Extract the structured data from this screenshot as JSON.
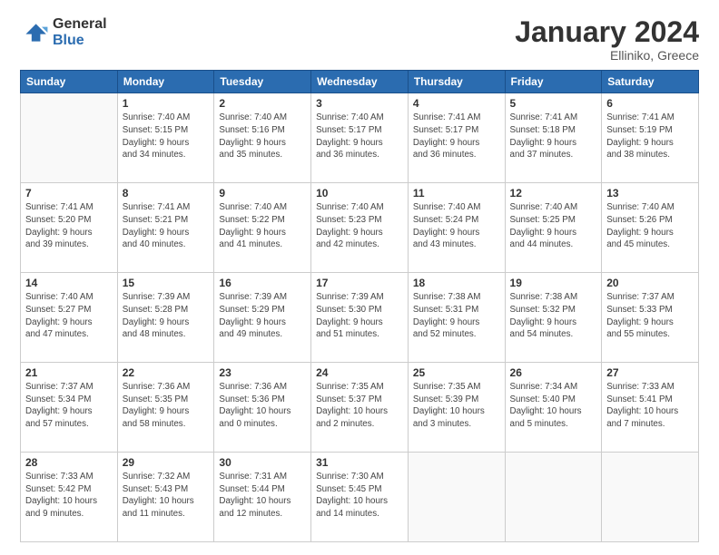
{
  "logo": {
    "general": "General",
    "blue": "Blue"
  },
  "title": "January 2024",
  "location": "Elliniko, Greece",
  "days_header": [
    "Sunday",
    "Monday",
    "Tuesday",
    "Wednesday",
    "Thursday",
    "Friday",
    "Saturday"
  ],
  "weeks": [
    [
      {
        "day": "",
        "info": ""
      },
      {
        "day": "1",
        "info": "Sunrise: 7:40 AM\nSunset: 5:15 PM\nDaylight: 9 hours\nand 34 minutes."
      },
      {
        "day": "2",
        "info": "Sunrise: 7:40 AM\nSunset: 5:16 PM\nDaylight: 9 hours\nand 35 minutes."
      },
      {
        "day": "3",
        "info": "Sunrise: 7:40 AM\nSunset: 5:17 PM\nDaylight: 9 hours\nand 36 minutes."
      },
      {
        "day": "4",
        "info": "Sunrise: 7:41 AM\nSunset: 5:17 PM\nDaylight: 9 hours\nand 36 minutes."
      },
      {
        "day": "5",
        "info": "Sunrise: 7:41 AM\nSunset: 5:18 PM\nDaylight: 9 hours\nand 37 minutes."
      },
      {
        "day": "6",
        "info": "Sunrise: 7:41 AM\nSunset: 5:19 PM\nDaylight: 9 hours\nand 38 minutes."
      }
    ],
    [
      {
        "day": "7",
        "info": "Sunrise: 7:41 AM\nSunset: 5:20 PM\nDaylight: 9 hours\nand 39 minutes."
      },
      {
        "day": "8",
        "info": "Sunrise: 7:41 AM\nSunset: 5:21 PM\nDaylight: 9 hours\nand 40 minutes."
      },
      {
        "day": "9",
        "info": "Sunrise: 7:40 AM\nSunset: 5:22 PM\nDaylight: 9 hours\nand 41 minutes."
      },
      {
        "day": "10",
        "info": "Sunrise: 7:40 AM\nSunset: 5:23 PM\nDaylight: 9 hours\nand 42 minutes."
      },
      {
        "day": "11",
        "info": "Sunrise: 7:40 AM\nSunset: 5:24 PM\nDaylight: 9 hours\nand 43 minutes."
      },
      {
        "day": "12",
        "info": "Sunrise: 7:40 AM\nSunset: 5:25 PM\nDaylight: 9 hours\nand 44 minutes."
      },
      {
        "day": "13",
        "info": "Sunrise: 7:40 AM\nSunset: 5:26 PM\nDaylight: 9 hours\nand 45 minutes."
      }
    ],
    [
      {
        "day": "14",
        "info": "Sunrise: 7:40 AM\nSunset: 5:27 PM\nDaylight: 9 hours\nand 47 minutes."
      },
      {
        "day": "15",
        "info": "Sunrise: 7:39 AM\nSunset: 5:28 PM\nDaylight: 9 hours\nand 48 minutes."
      },
      {
        "day": "16",
        "info": "Sunrise: 7:39 AM\nSunset: 5:29 PM\nDaylight: 9 hours\nand 49 minutes."
      },
      {
        "day": "17",
        "info": "Sunrise: 7:39 AM\nSunset: 5:30 PM\nDaylight: 9 hours\nand 51 minutes."
      },
      {
        "day": "18",
        "info": "Sunrise: 7:38 AM\nSunset: 5:31 PM\nDaylight: 9 hours\nand 52 minutes."
      },
      {
        "day": "19",
        "info": "Sunrise: 7:38 AM\nSunset: 5:32 PM\nDaylight: 9 hours\nand 54 minutes."
      },
      {
        "day": "20",
        "info": "Sunrise: 7:37 AM\nSunset: 5:33 PM\nDaylight: 9 hours\nand 55 minutes."
      }
    ],
    [
      {
        "day": "21",
        "info": "Sunrise: 7:37 AM\nSunset: 5:34 PM\nDaylight: 9 hours\nand 57 minutes."
      },
      {
        "day": "22",
        "info": "Sunrise: 7:36 AM\nSunset: 5:35 PM\nDaylight: 9 hours\nand 58 minutes."
      },
      {
        "day": "23",
        "info": "Sunrise: 7:36 AM\nSunset: 5:36 PM\nDaylight: 10 hours\nand 0 minutes."
      },
      {
        "day": "24",
        "info": "Sunrise: 7:35 AM\nSunset: 5:37 PM\nDaylight: 10 hours\nand 2 minutes."
      },
      {
        "day": "25",
        "info": "Sunrise: 7:35 AM\nSunset: 5:39 PM\nDaylight: 10 hours\nand 3 minutes."
      },
      {
        "day": "26",
        "info": "Sunrise: 7:34 AM\nSunset: 5:40 PM\nDaylight: 10 hours\nand 5 minutes."
      },
      {
        "day": "27",
        "info": "Sunrise: 7:33 AM\nSunset: 5:41 PM\nDaylight: 10 hours\nand 7 minutes."
      }
    ],
    [
      {
        "day": "28",
        "info": "Sunrise: 7:33 AM\nSunset: 5:42 PM\nDaylight: 10 hours\nand 9 minutes."
      },
      {
        "day": "29",
        "info": "Sunrise: 7:32 AM\nSunset: 5:43 PM\nDaylight: 10 hours\nand 11 minutes."
      },
      {
        "day": "30",
        "info": "Sunrise: 7:31 AM\nSunset: 5:44 PM\nDaylight: 10 hours\nand 12 minutes."
      },
      {
        "day": "31",
        "info": "Sunrise: 7:30 AM\nSunset: 5:45 PM\nDaylight: 10 hours\nand 14 minutes."
      },
      {
        "day": "",
        "info": ""
      },
      {
        "day": "",
        "info": ""
      },
      {
        "day": "",
        "info": ""
      }
    ]
  ]
}
